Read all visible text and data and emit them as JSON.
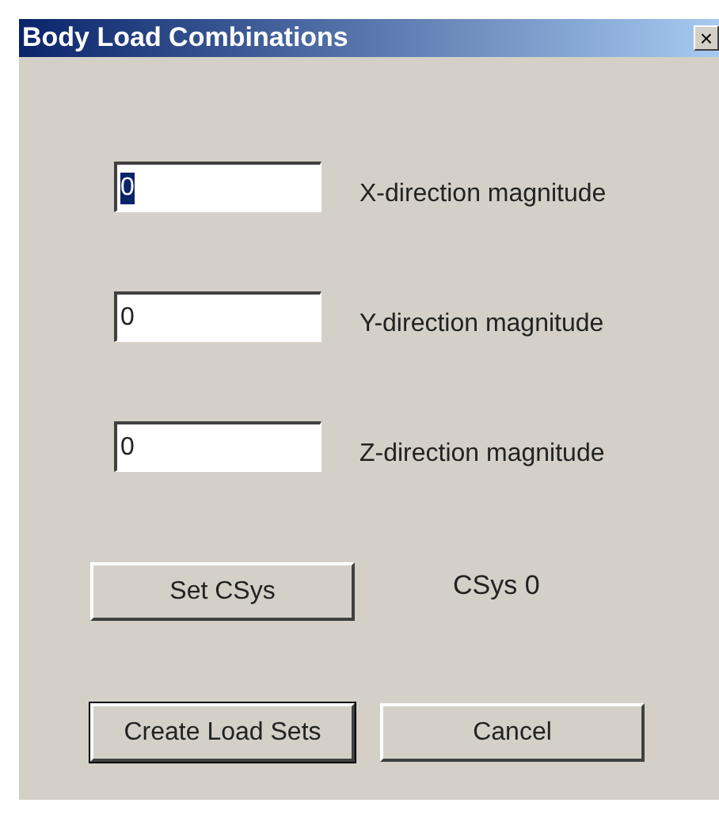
{
  "window": {
    "title": "Body Load Combinations",
    "close": "×"
  },
  "fields": [
    {
      "value": "0",
      "label": "X-direction magnitude",
      "selected": true
    },
    {
      "value": "0",
      "label": "Y-direction magnitude",
      "selected": false
    },
    {
      "value": "0",
      "label": "Z-direction magnitude",
      "selected": false
    }
  ],
  "csys": {
    "button": "Set CSys",
    "reading": "CSys 0"
  },
  "buttons": [
    {
      "label": "Create Load Sets",
      "default": true
    },
    {
      "label": "Cancel",
      "default": false
    }
  ]
}
